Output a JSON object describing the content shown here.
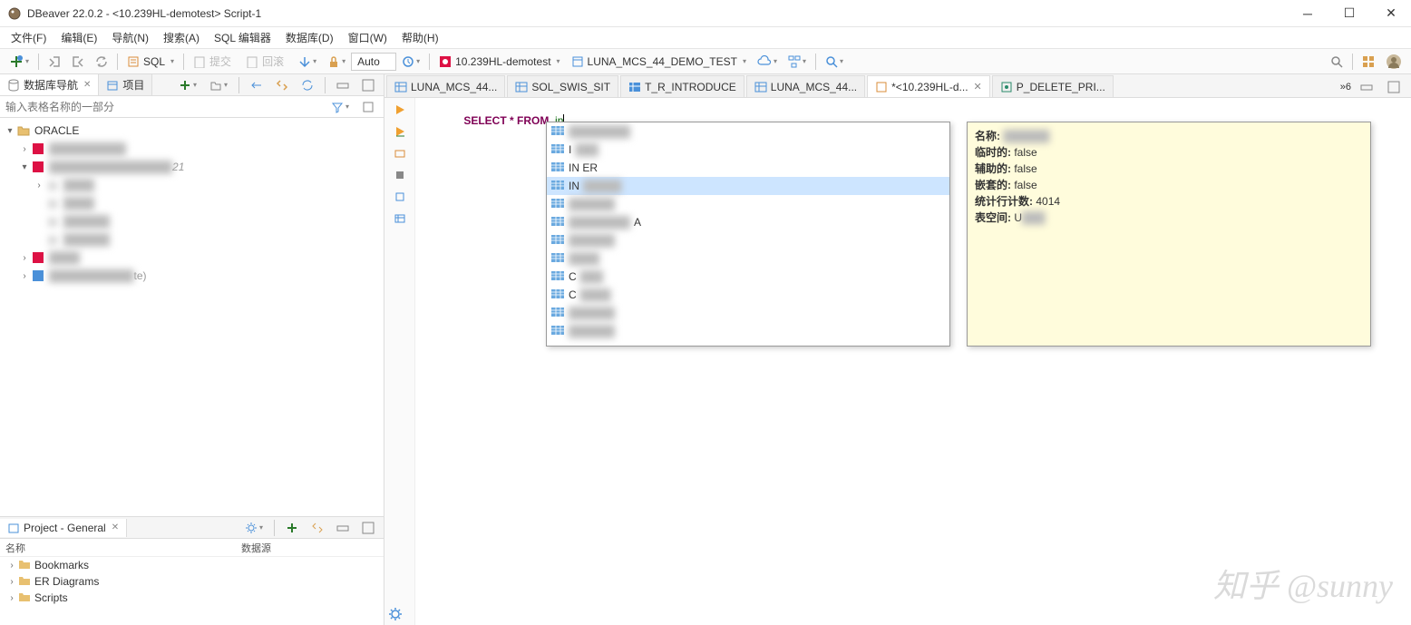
{
  "title": "DBeaver 22.0.2 - <10.239HL-demotest> Script-1",
  "menu": [
    "文件(F)",
    "编辑(E)",
    "导航(N)",
    "搜索(A)",
    "SQL 编辑器",
    "数据库(D)",
    "窗口(W)",
    "帮助(H)"
  ],
  "toolbar": {
    "sql_label": "SQL",
    "commit_label": "提交",
    "rollback_label": "回滚",
    "auto": "Auto",
    "conn": "10.239HL-demotest",
    "schema": "LUNA_MCS_44_DEMO_TEST"
  },
  "nav": {
    "tab1": "数据库导航",
    "tab2": "项目",
    "filter_placeholder": "输入表格名称的一部分",
    "root": "ORACLE",
    "blur_tail": "21",
    "blur_tail2": "te)"
  },
  "project_panel": {
    "title": "Project - General",
    "cols": [
      "名称",
      "数据源"
    ],
    "items": [
      "Bookmarks",
      "ER Diagrams",
      "Scripts"
    ]
  },
  "editor_tabs": [
    {
      "label": "LUNA_MCS_44...",
      "icon": "table"
    },
    {
      "label": "SOL_SWIS_SIT",
      "icon": "table"
    },
    {
      "label": "T_R_INTRODUCE",
      "icon": "table-blue"
    },
    {
      "label": "LUNA_MCS_44...",
      "icon": "table"
    },
    {
      "label": "*<10.239HL-d...",
      "icon": "sql",
      "active": true,
      "close": true
    },
    {
      "label": "P_DELETE_PRI...",
      "icon": "proc"
    }
  ],
  "tabs_overflow": "»6",
  "sql": {
    "select": "SELECT",
    "star": "*",
    "from": "FROM",
    "typed": "in"
  },
  "autocomplete": {
    "items": [
      {
        "t": "",
        "sel": false
      },
      {
        "t": "I",
        "sel": false
      },
      {
        "t": "IN                    ER",
        "sel": false
      },
      {
        "t": "IN",
        "sel": true
      },
      {
        "t": "",
        "sel": false
      },
      {
        "t": "A",
        "sel": false
      },
      {
        "t": "",
        "sel": false
      },
      {
        "t": "",
        "sel": false
      },
      {
        "t": "C",
        "sel": false
      },
      {
        "t": "C",
        "sel": false
      },
      {
        "t": "",
        "sel": false
      },
      {
        "t": "",
        "sel": false
      }
    ]
  },
  "info": {
    "k1": "名称:",
    "v1": "",
    "k2": "临时的:",
    "v2": "false",
    "k3": "辅助的:",
    "v3": "false",
    "k4": "嵌套的:",
    "v4": "false",
    "k5": "统计行计数:",
    "v5": "4014",
    "k6": "表空间:",
    "v6": "U"
  },
  "watermark": "知乎 @sunny"
}
